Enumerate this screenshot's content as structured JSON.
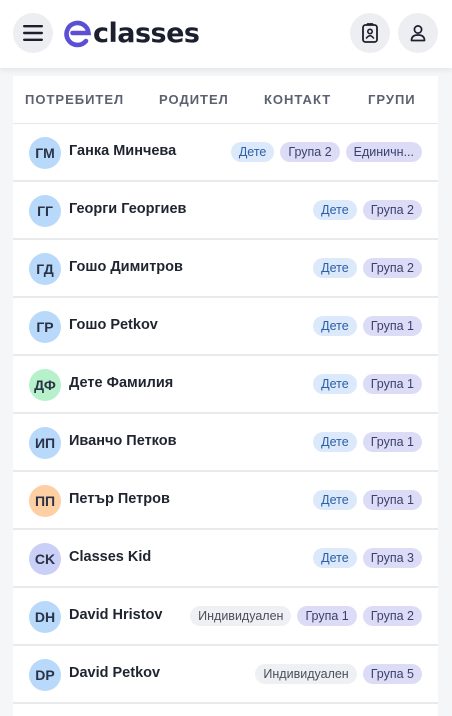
{
  "header": {
    "logo_text": "classes",
    "logo_color": "#5b4fd6",
    "icons": [
      "menu-icon",
      "contact-card-icon",
      "user-icon"
    ]
  },
  "table": {
    "columns": [
      "ПОТРЕБИТЕЛ",
      "РОДИТЕЛ",
      "КОНТАКТ",
      "ГРУПИ"
    ],
    "rows": [
      {
        "initials": "ГМ",
        "name": "Ганка Минчева",
        "tags": [
          "Дете",
          "Група 2",
          "Единичн..."
        ]
      },
      {
        "initials": "ГГ",
        "name": "Георги Георгиев",
        "tags": [
          "Дете",
          "Група 2"
        ]
      },
      {
        "initials": "ГД",
        "name": "Гошо Димитров",
        "tags": [
          "Дете",
          "Група 2"
        ]
      },
      {
        "initials": "ГР",
        "name": "Гошо Petkov",
        "tags": [
          "Дете",
          "Група 1"
        ]
      },
      {
        "initials": "ДФ",
        "name": "Дете Фамилия",
        "tags": [
          "Дете",
          "Група 1"
        ]
      },
      {
        "initials": "ИП",
        "name": "Иванчо Петков",
        "tags": [
          "Дете",
          "Група 1"
        ]
      },
      {
        "initials": "ПП",
        "name": "Петър Петров",
        "tags": [
          "Дете",
          "Група 1"
        ]
      },
      {
        "initials": "CK",
        "name": "Classes Kid",
        "tags": [
          "Дете",
          "Група 3"
        ]
      },
      {
        "initials": "DH",
        "name": "David Hristov",
        "tags": [
          "Индивидуален",
          "Група 1",
          "Група 2"
        ]
      },
      {
        "initials": "DP",
        "name": "David Petkov",
        "tags": [
          "Индивидуален",
          "Група 5"
        ]
      }
    ]
  }
}
